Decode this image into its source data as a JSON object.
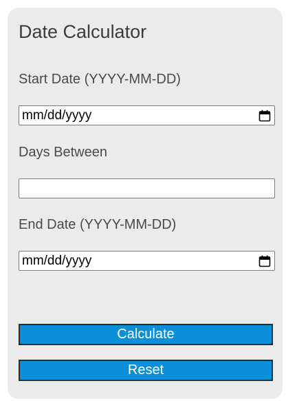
{
  "app": {
    "title": "Date Calculator"
  },
  "form": {
    "start_date": {
      "label": "Start Date (YYYY-MM-DD)",
      "value": "mm/dd/yyyy",
      "icon": "calendar-icon"
    },
    "days_between": {
      "label": "Days Between",
      "value": ""
    },
    "end_date": {
      "label": "End Date (YYYY-MM-DD)",
      "value": "mm/dd/yyyy",
      "icon": "calendar-icon"
    }
  },
  "buttons": {
    "calculate_label": "Calculate",
    "reset_label": "Reset"
  },
  "colors": {
    "card_background": "#ebebeb",
    "button_background": "#0b8fd8",
    "button_border": "#2a2a2a",
    "button_text": "#ffffff"
  }
}
